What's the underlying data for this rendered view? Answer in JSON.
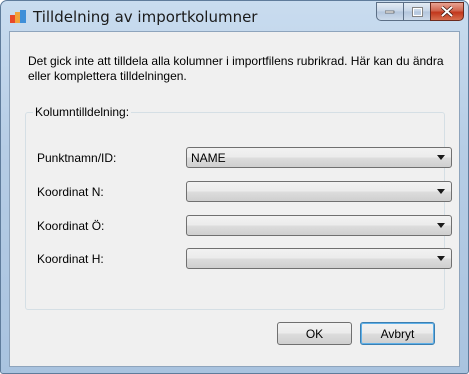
{
  "window": {
    "title": "Tilldelning av importkolumner",
    "controls": {
      "minimize": "minimize",
      "maximize": "maximize",
      "close": "close"
    }
  },
  "message": "Det gick inte att tilldela alla kolumner i importfilens rubrikrad. Här kan du ändra eller komplettera tilldelningen.",
  "group": {
    "title": "Kolumntilldelning:",
    "rows": [
      {
        "label": "Punktnamn/ID:",
        "value": "NAME"
      },
      {
        "label": "Koordinat N:",
        "value": ""
      },
      {
        "label": "Koordinat Ö:",
        "value": ""
      },
      {
        "label": "Koordinat H:",
        "value": ""
      }
    ]
  },
  "buttons": {
    "ok": "OK",
    "cancel": "Avbryt"
  },
  "colors": {
    "close_button": "#c2371c",
    "focus_border": "#3c7fb1"
  }
}
